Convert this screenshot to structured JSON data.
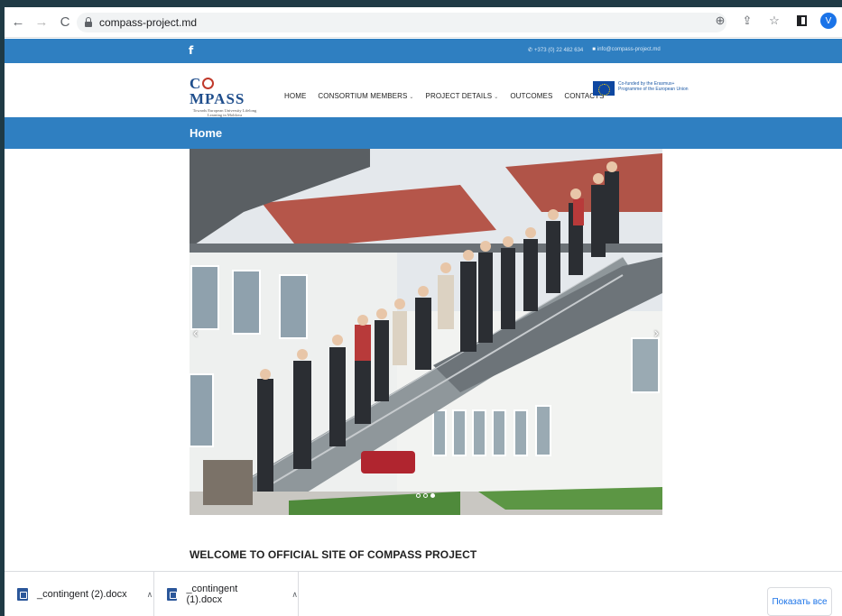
{
  "browser": {
    "url": "compass-project.md",
    "profile_initial": "V"
  },
  "topbar": {
    "facebook": "f",
    "phone": "+373 (0) 22 482 634",
    "email": "info@compass-project.md"
  },
  "header": {
    "logo_word": "COMPASS",
    "logo_sub": "Towards European University Lifelong Learning in Moldova",
    "menu": [
      {
        "label": "HOME",
        "has_dropdown": false
      },
      {
        "label": "CONSORTIUM MEMBERS",
        "has_dropdown": true
      },
      {
        "label": "PROJECT DETAILS",
        "has_dropdown": true
      },
      {
        "label": "OUTCOMES",
        "has_dropdown": false
      },
      {
        "label": "CONTACTS",
        "has_dropdown": false
      }
    ],
    "eu_text": "Co-funded by the Erasmus+ Programme of the European Union"
  },
  "page": {
    "title": "Home",
    "welcome": "WELCOME TO OFFICIAL SITE OF COMPASS PROJECT"
  },
  "slider": {
    "slide_count": 3,
    "active_index": 2
  },
  "downloads": {
    "items": [
      {
        "name": "_contingent (2).docx"
      },
      {
        "name": "_contingent (1).docx"
      }
    ],
    "show_all": "Показать все"
  },
  "colors": {
    "brand_blue": "#2f7fc1",
    "logo_blue": "#1f4e8c",
    "chrome_blue": "#1a73e8"
  }
}
